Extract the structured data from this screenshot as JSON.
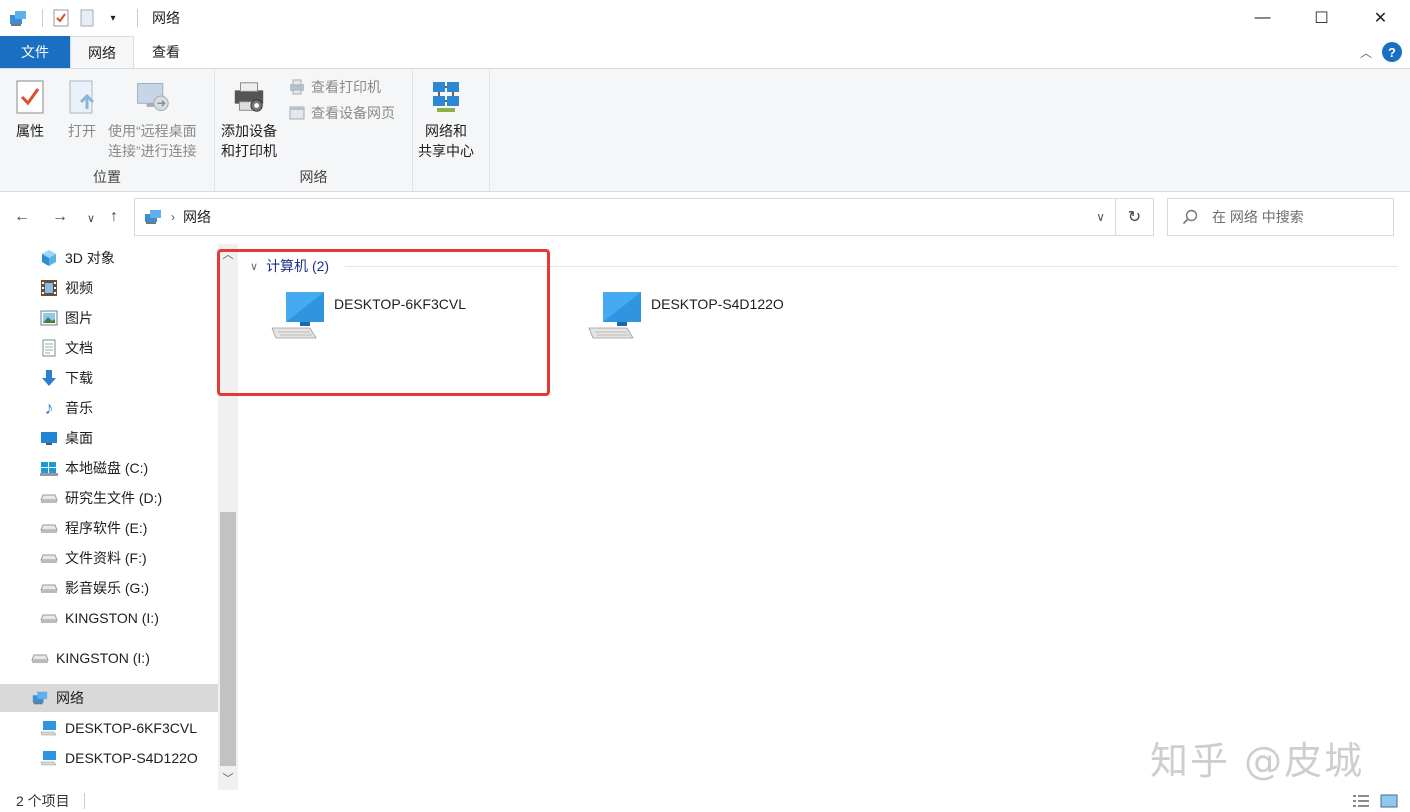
{
  "window": {
    "title": "网络",
    "minimize": "—",
    "maximize": "☐",
    "close": "✕"
  },
  "ribbon_tabs": [
    {
      "label": "文件"
    },
    {
      "label": "网络"
    },
    {
      "label": "查看"
    }
  ],
  "ribbon": {
    "location_group": {
      "label": "位置",
      "properties": "属性",
      "open": "打开",
      "remote_line1": "使用“远程桌面",
      "remote_line2": "连接”进行连接"
    },
    "network_group": {
      "label": "网络",
      "add_devices_line1": "添加设备",
      "add_devices_line2": "和打印机",
      "view_printers": "查看打印机",
      "view_device_webpage": "查看设备网页"
    },
    "sharing_center_line1": "网络和",
    "sharing_center_line2": "共享中心"
  },
  "address_bar": {
    "path": "网络"
  },
  "search": {
    "placeholder": "在 网络 中搜索"
  },
  "sidebar": {
    "items": [
      {
        "label": "3D 对象",
        "icon": "cube-3d-icon"
      },
      {
        "label": "视频",
        "icon": "video-icon"
      },
      {
        "label": "图片",
        "icon": "pictures-icon"
      },
      {
        "label": "文档",
        "icon": "documents-icon"
      },
      {
        "label": "下载",
        "icon": "download-icon"
      },
      {
        "label": "音乐",
        "icon": "music-icon"
      },
      {
        "label": "桌面",
        "icon": "desktop-icon"
      },
      {
        "label": "本地磁盘 (C:)",
        "icon": "windows-drive-icon"
      },
      {
        "label": "研究生文件 (D:)",
        "icon": "drive-icon"
      },
      {
        "label": "程序软件 (E:)",
        "icon": "drive-icon"
      },
      {
        "label": "文件资料 (F:)",
        "icon": "drive-icon"
      },
      {
        "label": "影音娱乐 (G:)",
        "icon": "drive-icon"
      },
      {
        "label": "KINGSTON (I:)",
        "icon": "usb-drive-icon"
      },
      {
        "label": "KINGSTON (I:)",
        "icon": "usb-drive-icon"
      },
      {
        "label": "网络",
        "icon": "network-icon"
      },
      {
        "label": "DESKTOP-6KF3CVL",
        "icon": "computer-icon"
      },
      {
        "label": "DESKTOP-S4D122O",
        "icon": "computer-icon"
      }
    ]
  },
  "main": {
    "group_title": "计算机 (2)",
    "computers": [
      {
        "name": "DESKTOP-6KF3CVL"
      },
      {
        "name": "DESKTOP-S4D122O"
      }
    ]
  },
  "status": {
    "item_count": "2 个项目"
  },
  "watermark": "知乎 @皮城",
  "colors": {
    "accent": "#1a6fc3",
    "highlight_box": "#e53935",
    "selected_bg": "#d9d9d9"
  }
}
